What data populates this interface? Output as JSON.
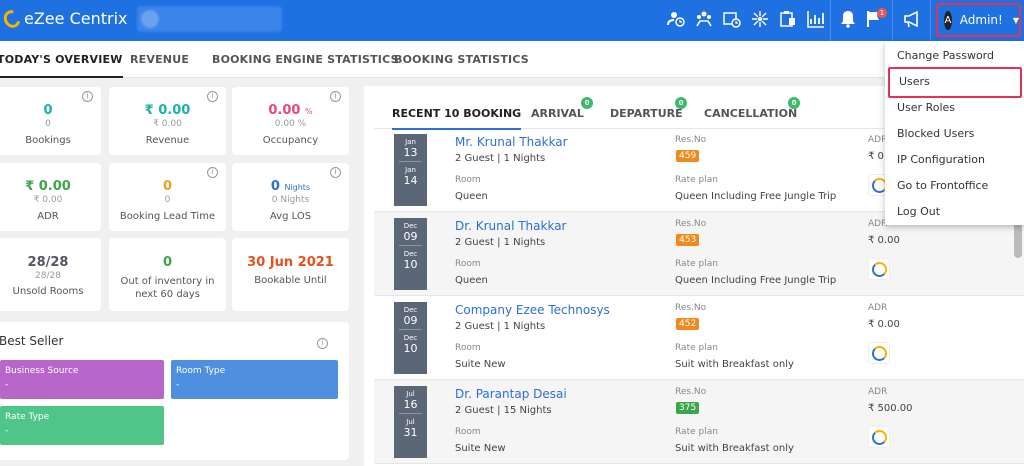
{
  "app": {
    "logo_text": "eZee Centrix",
    "colors": {
      "accent": "#1f70e0",
      "highlight": "#e3315a"
    }
  },
  "topbar": {
    "icons": [
      "user-clock-icon",
      "user-group-icon",
      "calendar-clock-icon",
      "network-icon",
      "clipboard-icon",
      "bar-chart-icon",
      "bell-icon",
      "flag-icon",
      "megaphone-icon"
    ],
    "flag_badge": "1",
    "user_initial": "A",
    "user_name": "Admin!"
  },
  "subnav": {
    "tabs": [
      "TODAY'S OVERVIEW",
      "REVENUE",
      "BOOKING ENGINE STATISTICS",
      "BOOKING STATISTICS"
    ]
  },
  "kpis": [
    {
      "value": "0",
      "sub": "0",
      "label": "Bookings"
    },
    {
      "value": "₹ 0.00",
      "sub": "₹ 0.00",
      "label": "Revenue"
    },
    {
      "value": "0.00",
      "unit": "%",
      "sub": "0.00 %",
      "label": "Occupancy"
    },
    {
      "value": "₹ 0.00",
      "sub": "₹ 0.00",
      "label": "ADR"
    },
    {
      "value": "0",
      "sub": "0",
      "label": "Booking Lead Time"
    },
    {
      "value": "0",
      "unit": "Nights",
      "sub": "0 Nights",
      "label": "Avg LOS"
    },
    {
      "value": "28/28",
      "sub": "28/28",
      "label": "Unsold Rooms"
    },
    {
      "value": "0",
      "label": "Out of inventory in next 60 days"
    },
    {
      "value": "30 Jun 2021",
      "label": "Bookable Until"
    }
  ],
  "best_seller": {
    "title": "Best Seller",
    "tiles": [
      {
        "label": "Business Source",
        "value": "-",
        "color": "#b667c9"
      },
      {
        "label": "Room Type",
        "value": "-",
        "color": "#4f8fe0"
      },
      {
        "label": "Rate Type",
        "value": "-",
        "color": "#4fc58a"
      }
    ]
  },
  "recent": {
    "tabs": [
      {
        "label": "RECENT 10 BOOKING"
      },
      {
        "label": "ARRIVAL",
        "badge": "0"
      },
      {
        "label": "DEPARTURE",
        "badge": "0"
      },
      {
        "label": "CANCELLATION",
        "badge": "0"
      }
    ],
    "labels": {
      "room": "Room",
      "resno": "Res.No",
      "rateplan": "Rate plan",
      "adr": "ADR"
    },
    "rows": [
      {
        "in_m": "Jan",
        "in_d": "13",
        "out_m": "Jan",
        "out_d": "14",
        "name": "Mr. Krunal Thakkar",
        "guests": "2 Guest | 1 Nights",
        "room": "Queen",
        "resno": "459",
        "resno_color": "#f08a1c",
        "rateplan": "Queen Including Free Jungle Trip",
        "adr": "₹ 0."
      },
      {
        "in_m": "Dec",
        "in_d": "09",
        "out_m": "Dec",
        "out_d": "10",
        "name": "Dr. Krunal Thakkar",
        "guests": "2 Guest | 1 Nights",
        "room": "Queen",
        "resno": "453",
        "resno_color": "#f08a1c",
        "rateplan": "Queen Including Free Jungle Trip",
        "adr": "₹ 0.00"
      },
      {
        "in_m": "Dec",
        "in_d": "09",
        "out_m": "Dec",
        "out_d": "10",
        "name": "Company Ezee Technosys",
        "guests": "2 Guest | 1 Nights",
        "room": "Suite New",
        "resno": "452",
        "resno_color": "#f08a1c",
        "rateplan": "Suit with Breakfast only",
        "adr": "₹ 0.00"
      },
      {
        "in_m": "Jul",
        "in_d": "16",
        "out_m": "Jul",
        "out_d": "31",
        "name": "Dr. Parantap Desai",
        "guests": "2 Guest | 15 Nights",
        "room": "Suite New",
        "resno": "375",
        "resno_color": "#3ba64a",
        "rateplan": "Suit with Breakfast only",
        "adr": "₹ 500.00"
      }
    ]
  },
  "dropdown": {
    "items": [
      "Change Password",
      "Users",
      "User Roles",
      "Blocked Users",
      "IP Configuration",
      "Go to Frontoffice",
      "Log Out"
    ]
  }
}
